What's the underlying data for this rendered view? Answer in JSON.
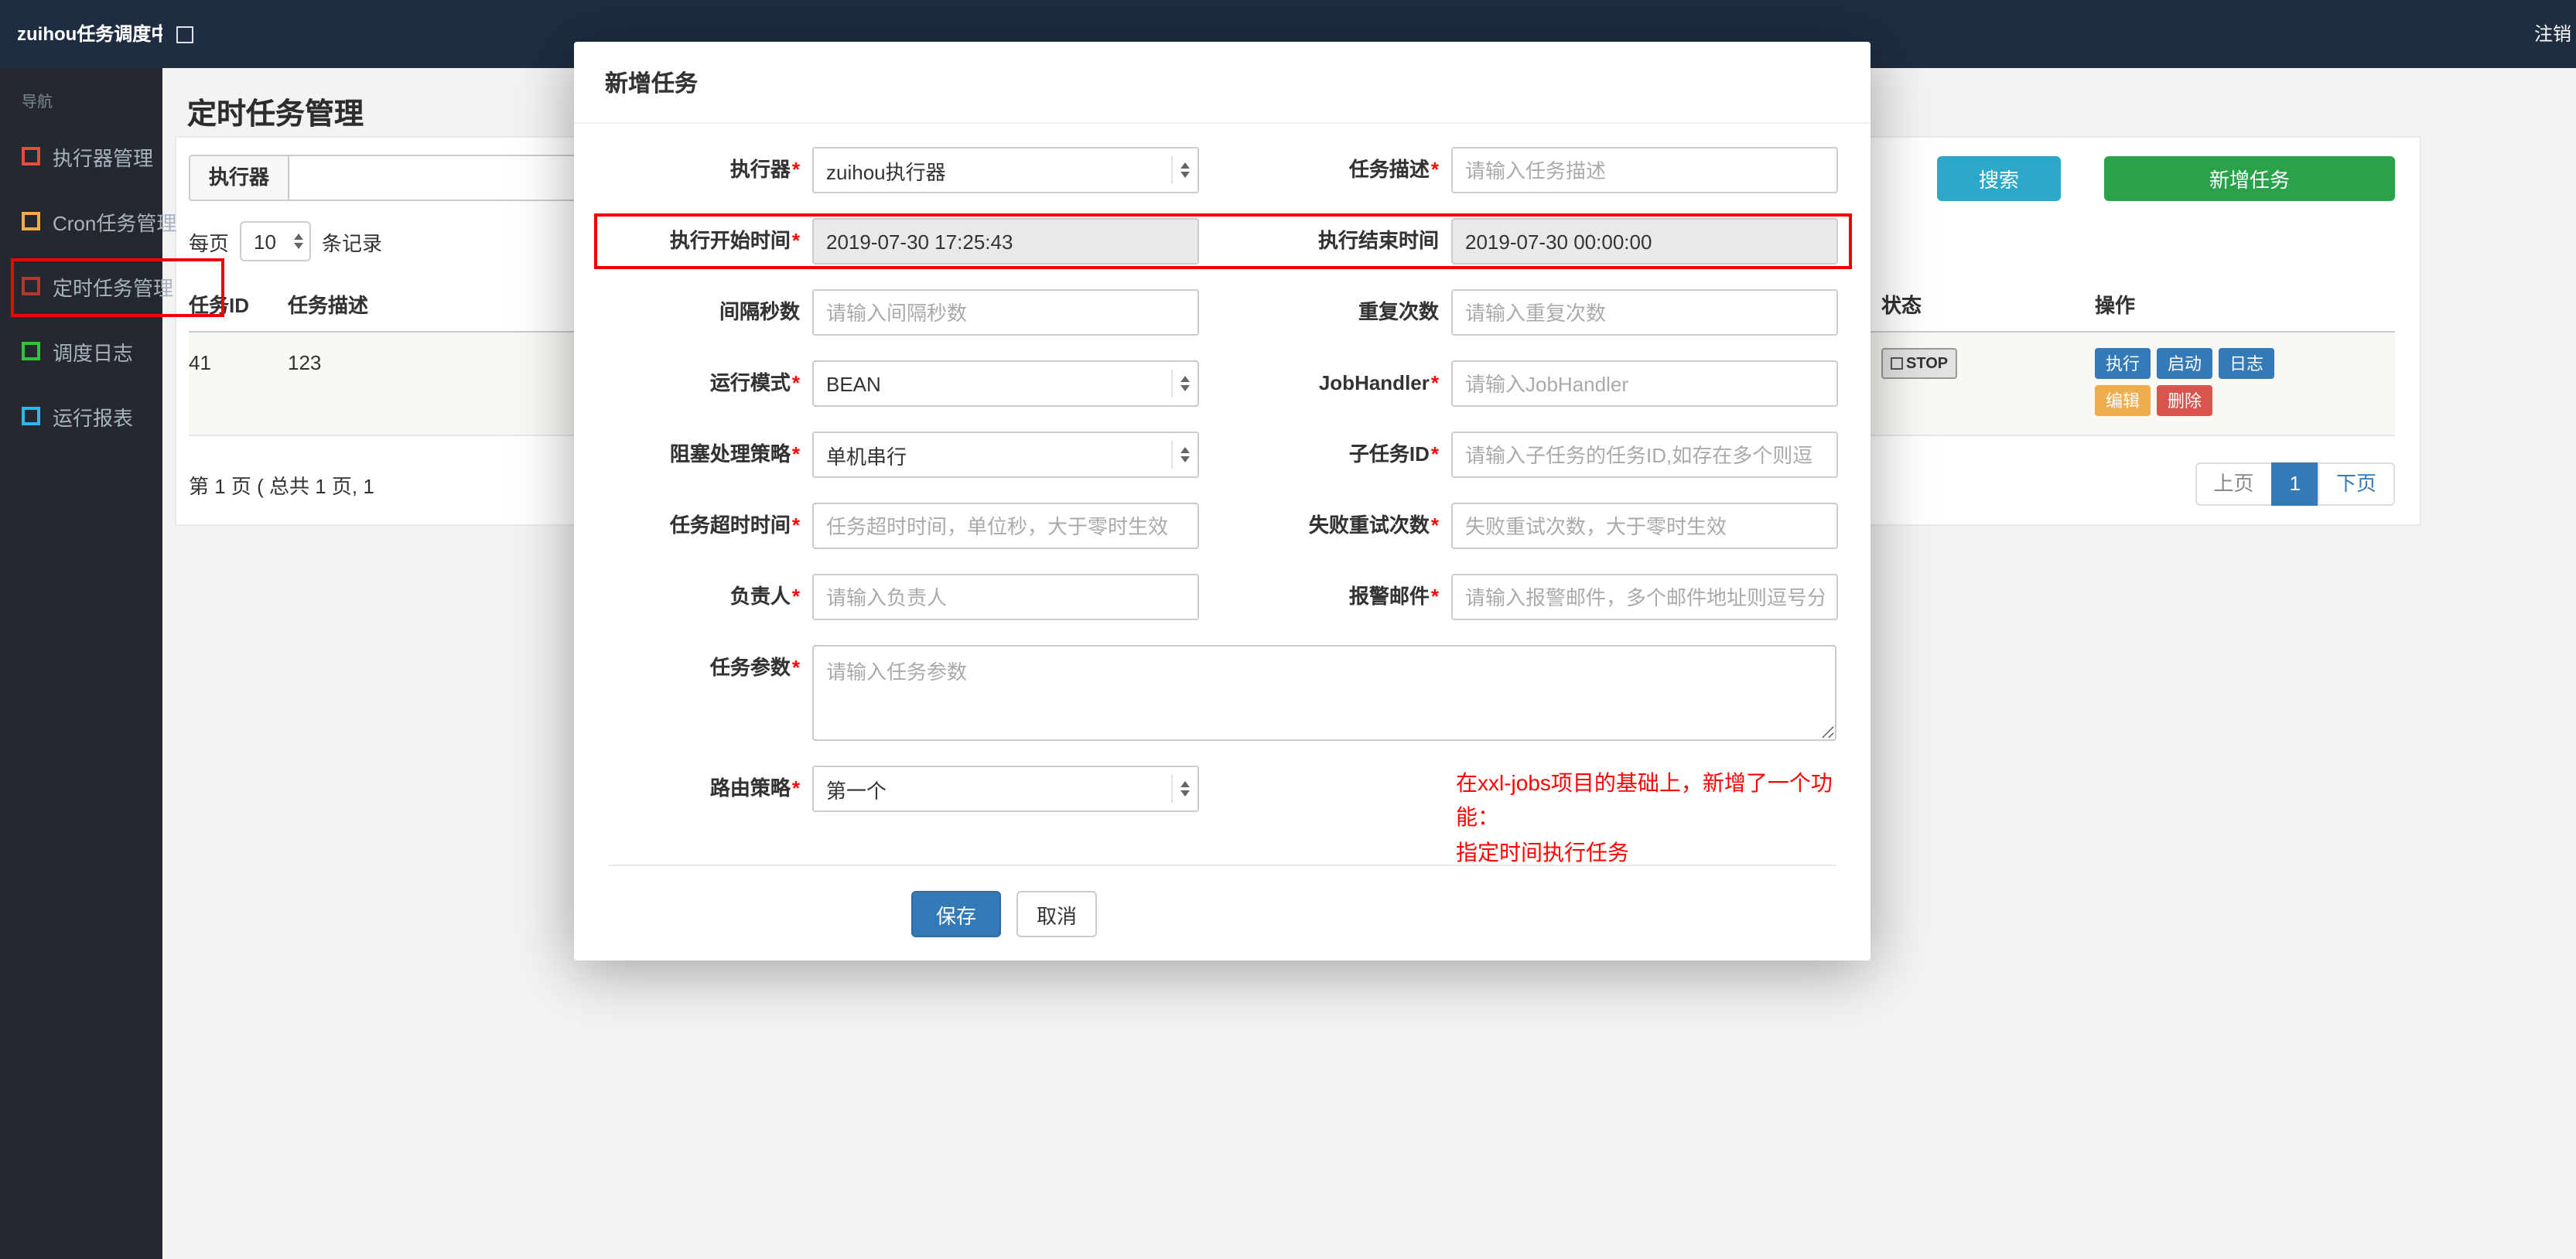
{
  "navbar": {
    "brand": "zuihou任务调度中心",
    "logout": "注销"
  },
  "sidebar": {
    "nav_label": "导航",
    "items": [
      {
        "label": "执行器管理",
        "icon": "square-outline-icon",
        "icon_color": "#e74c3c"
      },
      {
        "label": "Cron任务管理",
        "icon": "square-outline-icon",
        "icon_color": "#f0ad4e"
      },
      {
        "label": "定时任务管理",
        "icon": "square-outline-icon",
        "icon_color": "#b03a2e",
        "highlighted": true
      },
      {
        "label": "调度日志",
        "icon": "square-outline-icon",
        "icon_color": "#35c33f"
      },
      {
        "label": "运行报表",
        "icon": "square-outline-icon",
        "icon_color": "#33b5e5"
      }
    ]
  },
  "page": {
    "title": "定时任务管理"
  },
  "toolbar": {
    "executor_label": "执行器",
    "search_button": "搜索",
    "add_button": "新增任务"
  },
  "perpage": {
    "label": "每页",
    "value": "10",
    "suffix": "条记录"
  },
  "table": {
    "headers": [
      "任务ID",
      "任务描述",
      "状态",
      "操作"
    ],
    "row": {
      "job_id": "41",
      "job_desc": "123",
      "status": "STOP",
      "actions": [
        {
          "label": "执行",
          "color": "#337ab7"
        },
        {
          "label": "启动",
          "color": "#337ab7"
        },
        {
          "label": "日志",
          "color": "#337ab7"
        },
        {
          "label": "编辑",
          "color": "#f0ad4e"
        },
        {
          "label": "删除",
          "color": "#d9534f"
        }
      ]
    },
    "pagination": {
      "summary": "第 1 页 ( 总共 1 页, 1",
      "prev": "上页",
      "current": "1",
      "next": "下页"
    }
  },
  "modal": {
    "title": "新增任务",
    "required_marker": "*",
    "fields": {
      "executor": {
        "label": "执行器",
        "required": true,
        "type": "select",
        "value": "zuihou执行器"
      },
      "job_desc": {
        "label": "任务描述",
        "required": true,
        "placeholder": "请输入任务描述"
      },
      "start_time": {
        "label": "执行开始时间",
        "required": true,
        "readonly": true,
        "value": "2019-07-30 17:25:43"
      },
      "end_time": {
        "label": "执行结束时间",
        "required": false,
        "readonly": true,
        "value": "2019-07-30 00:00:00"
      },
      "interval_seconds": {
        "label": "间隔秒数",
        "required": false,
        "placeholder": "请输入间隔秒数"
      },
      "repeat_count": {
        "label": "重复次数",
        "required": false,
        "placeholder": "请输入重复次数"
      },
      "run_mode": {
        "label": "运行模式",
        "required": true,
        "type": "select",
        "value": "BEAN"
      },
      "job_handler": {
        "label": "JobHandler",
        "required": true,
        "placeholder": "请输入JobHandler"
      },
      "block_strategy": {
        "label": "阻塞处理策略",
        "required": true,
        "type": "select",
        "value": "单机串行"
      },
      "child_job_id": {
        "label": "子任务ID",
        "required": true,
        "placeholder": "请输入子任务的任务ID,如存在多个则逗"
      },
      "timeout": {
        "label": "任务超时时间",
        "required": true,
        "placeholder": "任务超时时间，单位秒，大于零时生效"
      },
      "fail_retry": {
        "label": "失败重试次数",
        "required": true,
        "placeholder": "失败重试次数，大于零时生效"
      },
      "owner": {
        "label": "负责人",
        "required": true,
        "placeholder": "请输入负责人"
      },
      "alarm_email": {
        "label": "报警邮件",
        "required": true,
        "placeholder": "请输入报警邮件，多个邮件地址则逗号分"
      },
      "job_param": {
        "label": "任务参数",
        "required": true,
        "type": "textarea",
        "placeholder": "请输入任务参数"
      },
      "route_strategy": {
        "label": "路由策略",
        "required": true,
        "type": "select",
        "value": "第一个"
      }
    },
    "note_line1": "在xxl-jobs项目的基础上，新增了一个功能：",
    "note_line2": "指定时间执行任务",
    "save_button": "保存",
    "cancel_button": "取消"
  },
  "colors": {
    "navbar_bg": "#1e2d41",
    "sidebar_bg": "#25292f",
    "search_button": "#2ca8c9",
    "add_button": "#2aa24c",
    "save_button": "#337ab7",
    "annotation_red": "#f20000",
    "note_text": "#ff0000"
  }
}
